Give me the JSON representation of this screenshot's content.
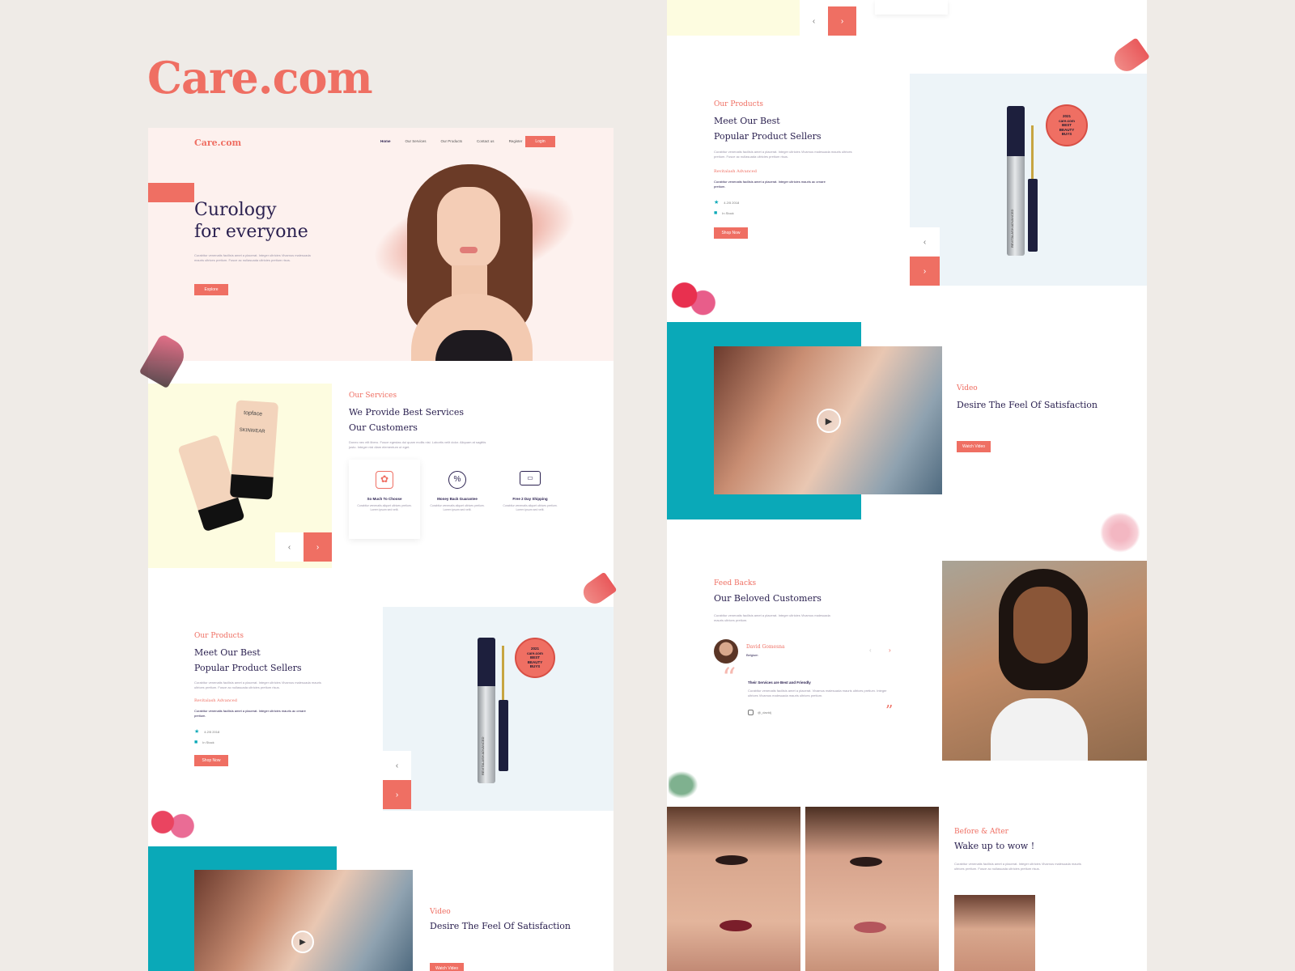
{
  "brand": {
    "showcase_title": "Care.com",
    "logo": "Care.com"
  },
  "nav": {
    "items": [
      "Home",
      "Our Services",
      "Our Products",
      "Contact us",
      "Register"
    ],
    "login": "Login"
  },
  "hero": {
    "title_line1": "Curology",
    "title_line2": "for everyone",
    "text": "Curabitur venenatis facilisis amet a placerat. Integer ultricies Vivamus malesuada mauris ultrices pretium. Fusce ac nullasuada ultricies pretium risus.",
    "button": "Explore"
  },
  "services": {
    "tag": "Our Services",
    "title_line1": "We Provide Best Services",
    "title_line2": "Our Customers",
    "text": "Donec nec elit libero. Fusce egestas dui quam mollis nisi. Lobortis velit dolor. Aliquam at sagittis justo. Integer nisl diam elementum ut eget.",
    "items": [
      {
        "icon": "beauty-products-icon",
        "title": "So Much To Choose",
        "text": "Curabitur venenatis aliquet ultrices pretium. Lorem ipsum sed velit."
      },
      {
        "icon": "money-back-icon",
        "title": "Money Back Guarantee",
        "text": "Curabitur venenatis aliquet ultrices pretium. Lorem ipsum sed velit."
      },
      {
        "icon": "delivery-truck-icon",
        "title": "Free 2 Day Shipping",
        "text": "Curabitur venenatis aliquet ultrices pretium. Lorem ipsum sed velit."
      }
    ],
    "prod_brand": "topface",
    "prod_name": "SKINWEAR"
  },
  "products": {
    "tag": "Our Products",
    "title_line1": "Meet Our Best",
    "title_line2": "Popular Product Sellers",
    "text": "Curabitur venenatis facilisis amet a placerat. Integer ultricies Vivamus malesuada mauris ultrices pretium. Fusce ac nullasuada ultricies pretium risus.",
    "product_name": "Revitalash Advanced",
    "product_desc": "Curabitur venenatis facilisis amet a placerat. Integer ultricies mauris ac ornare pretium.",
    "rating": "4.2/5 2018",
    "stock": "In Stock",
    "button": "Shop Now",
    "badge_lines": [
      "2021",
      "care.com",
      "BEST",
      "BEAUTY",
      "BUYS"
    ],
    "bottle_label": "REVITALASH ADVANCED"
  },
  "video": {
    "tag": "Video",
    "title": "Desire The Feel Of Satisfaction",
    "button": "Watch Video"
  },
  "feedback": {
    "tag": "Feed Backs",
    "title": "Our Beloved Customers",
    "text": "Curabitur venenatis facilisis amet a placerat. Integer ultricies Vivamus malesuada mauris ultrices pretium.",
    "name": "David Gomesna",
    "location": "Belgium",
    "quote_title": "Their Services are Best and Friendly",
    "quote": "Curabitur venenatis facilisis amet a placerat. Vivamus malesuada mauris ultrices pretium. Integer ultrices Vivamus malesuada mauris ultrices pretium.",
    "handle": "@_davidj"
  },
  "before_after": {
    "tag": "Before & After",
    "title": "Wake up to wow !",
    "text": "Curabitur venenatis facilisis amet a placerat. Integer ultricies Vivamus malesuada mauris ultrices pretium. Fusce ac nullasuada ultricies pretium risus."
  },
  "arrows": {
    "prev": "‹",
    "next": "›"
  },
  "quote_marks": {
    "open": "“",
    "close": "”"
  },
  "colors": {
    "accent": "#ef6f63",
    "navy": "#2b2150",
    "teal": "#0aa9b8",
    "blush": "#fdf1ee",
    "cream": "#fdfce0",
    "ice": "#edf4f8"
  }
}
